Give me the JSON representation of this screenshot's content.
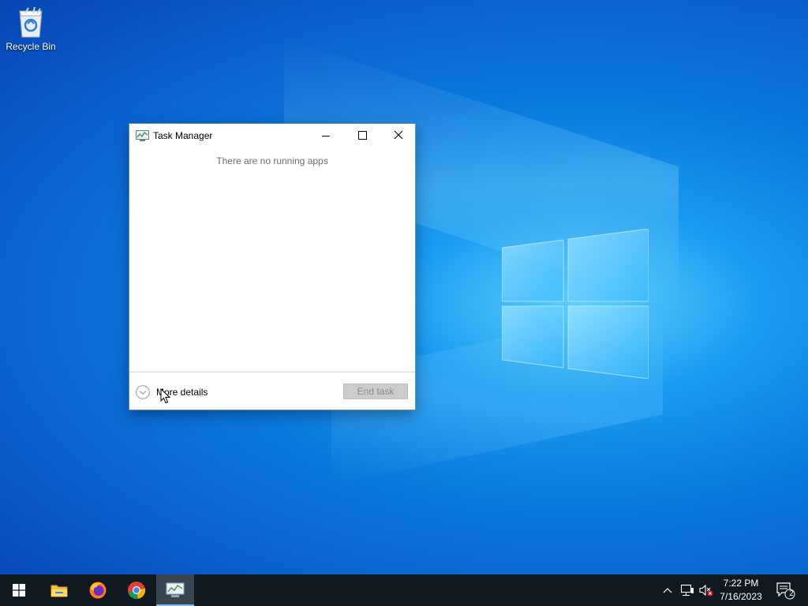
{
  "desktop": {
    "icons": [
      {
        "label": "Recycle Bin",
        "icon": "recycle-bin-icon"
      }
    ]
  },
  "window": {
    "title": "Task Manager",
    "icon": "task-manager-icon",
    "controls": {
      "minimize": "minimize-icon",
      "maximize": "maximize-icon",
      "close": "close-icon"
    },
    "empty_message": "There are no running apps",
    "more_details_label": "More details",
    "end_task_label": "End task"
  },
  "taskbar": {
    "start": "windows-start-icon",
    "pinned": [
      {
        "name": "file-explorer-icon"
      },
      {
        "name": "firefox-icon"
      },
      {
        "name": "chrome-icon"
      },
      {
        "name": "task-manager-icon",
        "active": true
      }
    ],
    "tray": {
      "chevron": "chevron-up-icon",
      "network": "network-icon",
      "volume": "volume-muted-icon",
      "time": "7:22 PM",
      "date": "7/16/2023",
      "notifications_count": "2"
    }
  },
  "colors": {
    "accent": "#0a78dc",
    "taskbar": "#101820",
    "active_indicator": "#76b9ed"
  }
}
